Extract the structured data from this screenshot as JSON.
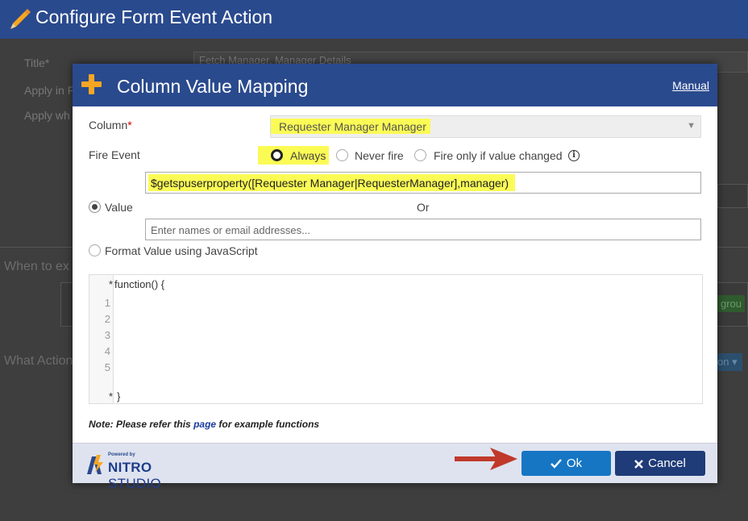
{
  "page": {
    "title": "Configure Form Event Action",
    "bg_fields": {
      "title_label": "Title*",
      "title_value": "Fetch Manager, Manager Details",
      "apply_in_label": "Apply in F",
      "apply_when_label": "Apply wh",
      "when_section": "When to ex",
      "what_section": "What Action",
      "green_button": "grou",
      "blue_button": "on ▾"
    }
  },
  "dialog": {
    "title": "Column Value Mapping",
    "manual_link": "Manual",
    "column_label": "Column",
    "required_mark": "*",
    "column_value": "Requester Manager Manager",
    "fire_event_label": "Fire Event",
    "fire_options": [
      {
        "label": "Always",
        "selected": true
      },
      {
        "label": "Never fire",
        "selected": false
      },
      {
        "label": "Fire only if value changed",
        "selected": false
      }
    ],
    "info_glyph": "i",
    "expression_value": "$getspuserproperty([Requester Manager|RequesterManager],manager)",
    "value_label": "Value",
    "or_text": "Or",
    "people_placeholder": "Enter names or email addresses...",
    "format_js_label": "Format Value using JavaScript",
    "code": {
      "header_marker": "*",
      "first_line": "function() {",
      "line_numbers": [
        "1",
        "2",
        "3",
        "4",
        "5"
      ],
      "footer_marker": "*",
      "last_line": "}"
    },
    "note": {
      "prefix": "Note: Please refer this ",
      "link": "page",
      "suffix": " for example functions"
    },
    "footer": {
      "powered_by": "Powered by",
      "brand_bold": "NITRO",
      "brand_light": " STUDIO",
      "ok_label": "Ok",
      "cancel_label": "Cancel"
    }
  },
  "colors": {
    "header_blue": "#2a4a8e",
    "highlight_yellow": "#fbfb55",
    "ok_button": "#1676c4",
    "cancel_button": "#1f3b78",
    "arrow_red": "#c0392b",
    "plus_orange": "#f5a623"
  },
  "icons": {
    "page_title": "pencil-icon",
    "dialog_title": "plus-icon",
    "ok": "checkmark-icon",
    "cancel": "x-icon",
    "fire_info": "info-icon",
    "pointer": "arrow-icon"
  }
}
